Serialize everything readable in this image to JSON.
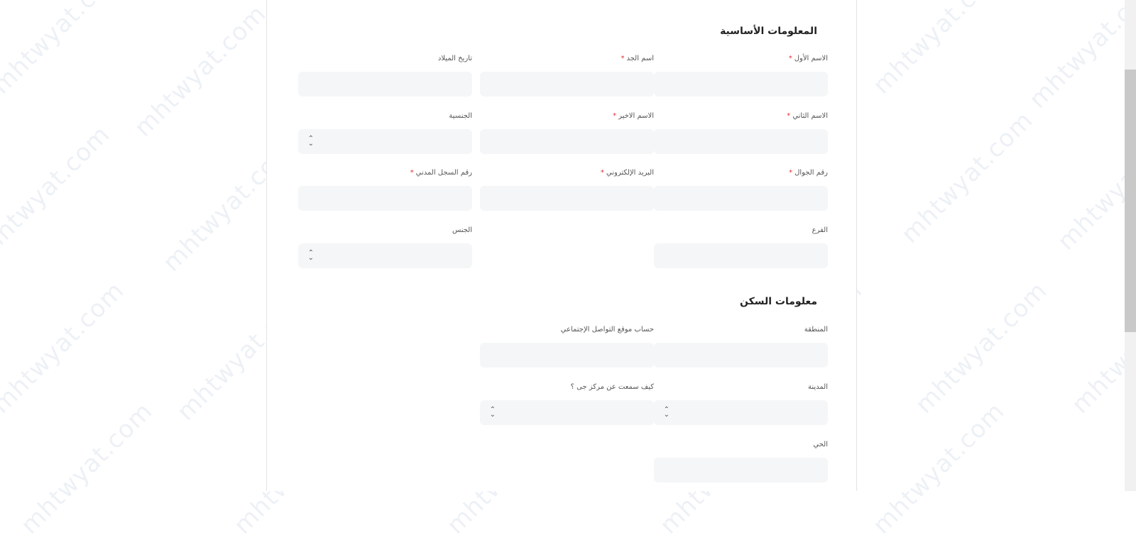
{
  "watermark": "mhtwyat.com",
  "basic_info": {
    "title": "المعلومات الأساسية",
    "fields": {
      "first_name": {
        "label": "الاسم الأول",
        "required": "*"
      },
      "grandfather_name": {
        "label": "اسم الجد",
        "required": "*"
      },
      "birth_date": {
        "label": "تاريخ الميلاد"
      },
      "second_name": {
        "label": "الاسم الثاني",
        "required": "*"
      },
      "last_name": {
        "label": "الاسم الاخير",
        "required": "*"
      },
      "nationality": {
        "label": "الجنسية"
      },
      "mobile": {
        "label": "رقم الجوال",
        "required": "*"
      },
      "email": {
        "label": "البريد الإلكتروني",
        "required": "*"
      },
      "civil_id": {
        "label": "رقم السجل المدني",
        "required": "*"
      },
      "branch": {
        "label": "الفرع"
      },
      "gender": {
        "label": "الجنس"
      }
    }
  },
  "residence_info": {
    "title": "معلومات السكن",
    "fields": {
      "region": {
        "label": "المنطقة"
      },
      "social_account": {
        "label": "حساب موقع التواصل الإجتماعي"
      },
      "city": {
        "label": "المدينة"
      },
      "heard_from": {
        "label": "كيف سمعت عن مركز جى ؟"
      },
      "district": {
        "label": "الحي"
      }
    }
  },
  "icons": {
    "select_arrow": "⌃⌄"
  }
}
